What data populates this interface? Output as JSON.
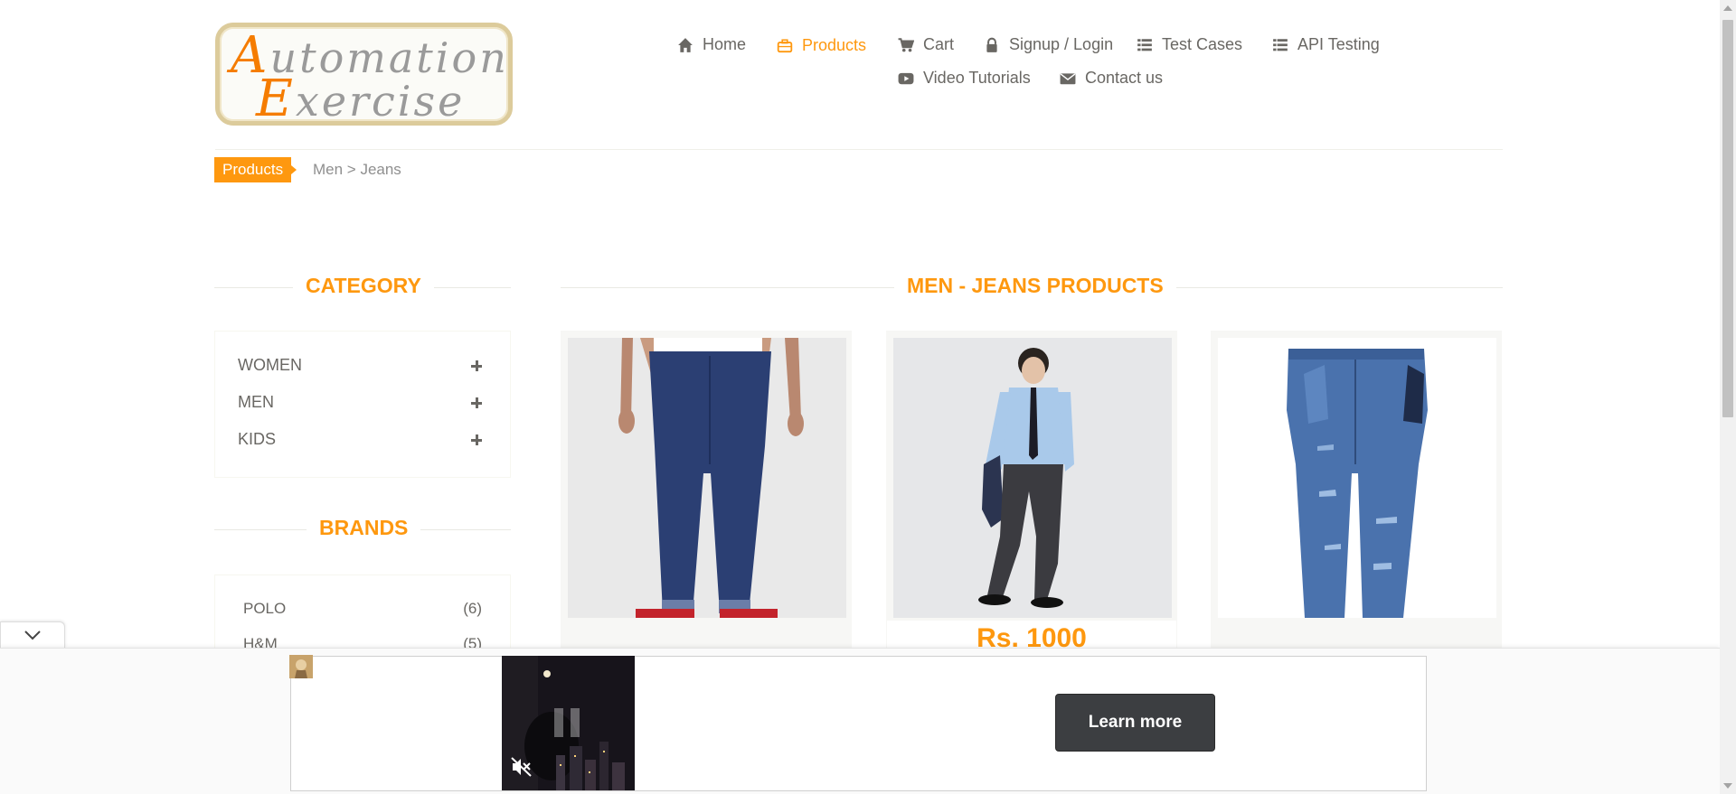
{
  "header": {
    "logo": {
      "line1": "Automation",
      "line2": "Exercise"
    },
    "nav": [
      {
        "label": "Home",
        "icon": "home-icon"
      },
      {
        "label": "Products",
        "icon": "briefcase-icon",
        "active": true
      },
      {
        "label": "Cart",
        "icon": "cart-icon"
      },
      {
        "label": "Signup / Login",
        "icon": "lock-icon"
      },
      {
        "label": "Test Cases",
        "icon": "list-icon"
      },
      {
        "label": "API Testing",
        "icon": "list-icon"
      },
      {
        "label": "Video Tutorials",
        "icon": "youtube-play-icon"
      },
      {
        "label": "Contact us",
        "icon": "envelope-icon"
      }
    ]
  },
  "breadcrumb": {
    "active": "Products",
    "path": "Men > Jeans"
  },
  "sidebar": {
    "category_title": "Category",
    "categories": [
      {
        "label": "WOMEN"
      },
      {
        "label": "MEN"
      },
      {
        "label": "KIDS"
      }
    ],
    "brands_title": "Brands",
    "brands": [
      {
        "name": "POLO",
        "count": "(6)"
      },
      {
        "name": "H&M",
        "count": "(5)"
      }
    ]
  },
  "main": {
    "title": "Men - Jeans Products",
    "products": [
      {
        "image": "dark-blue-slim-jeans"
      },
      {
        "image": "dark-grey-jeans-model"
      },
      {
        "image": "distressed-light-blue-jeans"
      }
    ],
    "visible_price_fragment": "Rs. 1000"
  },
  "ad": {
    "cta": "Learn more",
    "mute_icon": "muted-speaker-icon"
  },
  "colors": {
    "accent": "#fe980f",
    "text": "#696763",
    "ad_button": "#3c3e41"
  }
}
